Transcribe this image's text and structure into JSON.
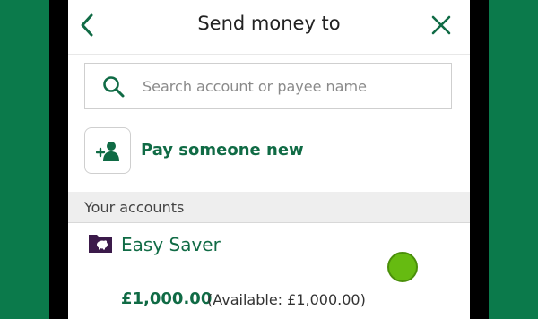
{
  "header": {
    "title": "Send money to"
  },
  "search": {
    "placeholder": "Search account or payee name",
    "value": ""
  },
  "pay_new": {
    "label": "Pay someone new"
  },
  "section": {
    "label": "Your accounts"
  },
  "accounts": [
    {
      "name": "Easy Saver",
      "balance": "£1,000.00",
      "available": "(Available: £1,000.00)",
      "icon": "piggy-bank-icon"
    }
  ],
  "colors": {
    "brand_green": "#106b45",
    "background_green": "#0b7a4b",
    "account_icon": "#3b1a4a",
    "cursor_marker": "#66bb11"
  }
}
